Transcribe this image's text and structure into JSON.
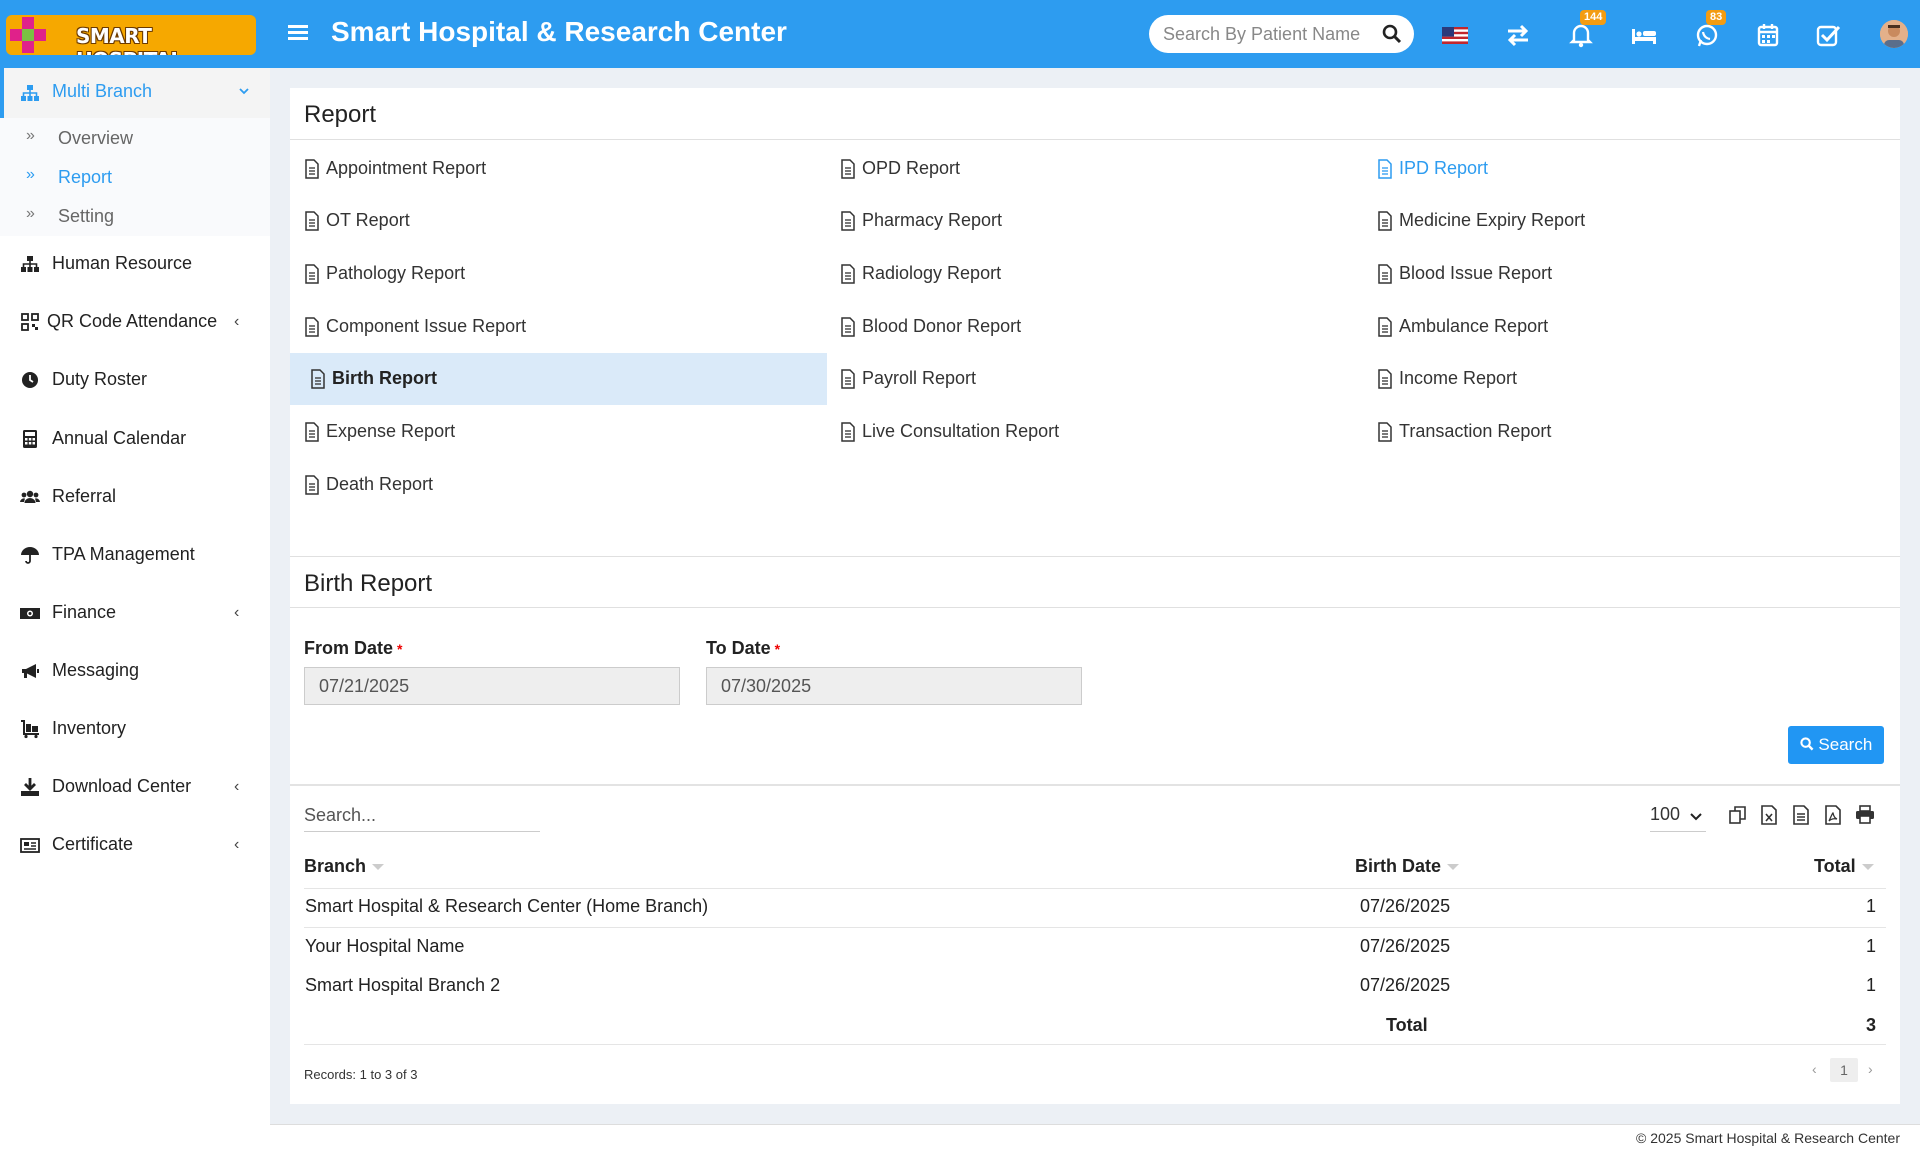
{
  "header": {
    "logo_text": "SMART HOSPITAL",
    "app_title": "Smart Hospital & Research Center",
    "search_placeholder": "Search By Patient Name",
    "notification_count": "144",
    "whatsapp_count": "83",
    "accent": "#2d9cf0"
  },
  "sidebar": {
    "multi_branch": {
      "label": "Multi Branch",
      "sub": [
        {
          "label": "Overview"
        },
        {
          "label": "Report"
        },
        {
          "label": "Setting"
        }
      ]
    },
    "items": [
      {
        "label": "Human Resource",
        "icon": "sitemap-icon"
      },
      {
        "label": "QR Code Attendance",
        "icon": "qrcode-icon"
      },
      {
        "label": "Duty Roster",
        "icon": "clock-icon"
      },
      {
        "label": "Annual Calendar",
        "icon": "calculator-icon"
      },
      {
        "label": "Referral",
        "icon": "users-icon"
      },
      {
        "label": "TPA Management",
        "icon": "umbrella-icon"
      },
      {
        "label": "Finance",
        "icon": "money-icon"
      },
      {
        "label": "Messaging",
        "icon": "bullhorn-icon"
      },
      {
        "label": "Inventory",
        "icon": "luggage-cart-icon"
      },
      {
        "label": "Download Center",
        "icon": "download-icon"
      },
      {
        "label": "Certificate",
        "icon": "newspaper-icon"
      }
    ]
  },
  "report_panel": {
    "title": "Report",
    "links": [
      [
        "Appointment Report",
        "OPD Report",
        "IPD Report"
      ],
      [
        "OT Report",
        "Pharmacy Report",
        "Medicine Expiry Report"
      ],
      [
        "Pathology Report",
        "Radiology Report",
        "Blood Issue Report"
      ],
      [
        "Component Issue Report",
        "Blood Donor Report",
        "Ambulance Report"
      ],
      [
        "Birth Report",
        "Payroll Report",
        "Income Report"
      ],
      [
        "Expense Report",
        "Live Consultation Report",
        "Transaction Report"
      ],
      [
        "Death Report"
      ]
    ]
  },
  "birth_report": {
    "title": "Birth Report",
    "from_label": "From Date",
    "from_value": "07/21/2025",
    "to_label": "To Date",
    "to_value": "07/30/2025",
    "search_button": "Search"
  },
  "table": {
    "search_placeholder": "Search...",
    "page_length": "100",
    "columns": [
      "Branch",
      "Birth Date",
      "Total"
    ],
    "rows": [
      [
        "Smart Hospital & Research Center (Home Branch)",
        "07/26/2025",
        "1"
      ],
      [
        "Your Hospital Name",
        "07/26/2025",
        "1"
      ],
      [
        "Smart Hospital Branch 2",
        "07/26/2025",
        "1"
      ]
    ],
    "total_label": "Total",
    "total_value": "3",
    "records": "Records: 1 to 3 of 3",
    "current_page": "1"
  },
  "footer": {
    "text": "© 2025 Smart Hospital & Research Center"
  }
}
